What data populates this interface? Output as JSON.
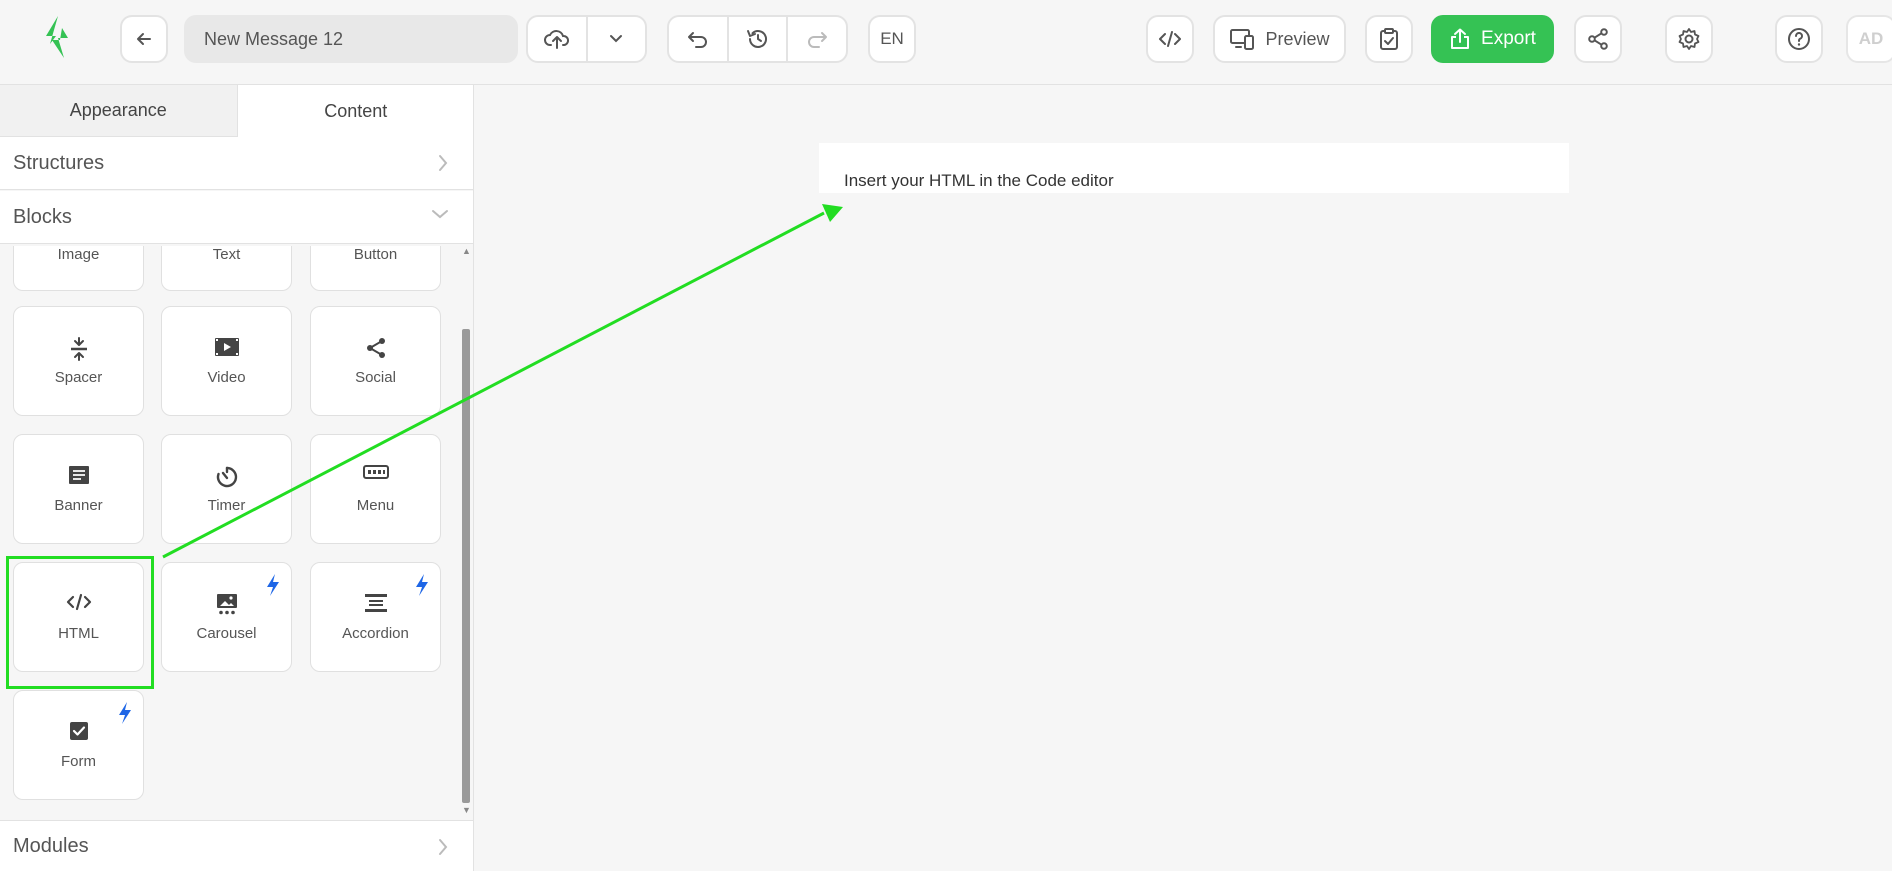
{
  "toolbar": {
    "message_name": "New Message 12",
    "language": "EN",
    "preview_label": "Preview",
    "export_label": "Export",
    "avatar_initials": "AD",
    "accent_color": "#35c254"
  },
  "sidebar": {
    "tabs": [
      {
        "label": "Appearance",
        "active": false
      },
      {
        "label": "Content",
        "active": true
      }
    ],
    "sections": {
      "structures": "Structures",
      "blocks": "Blocks",
      "modules": "Modules"
    },
    "blocks": [
      {
        "label": "Image",
        "icon": "image-icon"
      },
      {
        "label": "Text",
        "icon": "text-icon"
      },
      {
        "label": "Button",
        "icon": "button-icon"
      },
      {
        "label": "Spacer",
        "icon": "spacer-icon"
      },
      {
        "label": "Video",
        "icon": "video-icon"
      },
      {
        "label": "Social",
        "icon": "share-icon"
      },
      {
        "label": "Banner",
        "icon": "banner-icon"
      },
      {
        "label": "Timer",
        "icon": "timer-icon"
      },
      {
        "label": "Menu",
        "icon": "menu-icon"
      },
      {
        "label": "HTML",
        "icon": "code-icon"
      },
      {
        "label": "Carousel",
        "icon": "carousel-icon",
        "premium": true
      },
      {
        "label": "Accordion",
        "icon": "accordion-icon",
        "premium": true
      },
      {
        "label": "Form",
        "icon": "checkbox-icon",
        "premium": true
      }
    ]
  },
  "canvas": {
    "placeholder_text": "Insert your HTML in the Code editor"
  },
  "annotation": {
    "highlight_color": "#22dd22"
  }
}
